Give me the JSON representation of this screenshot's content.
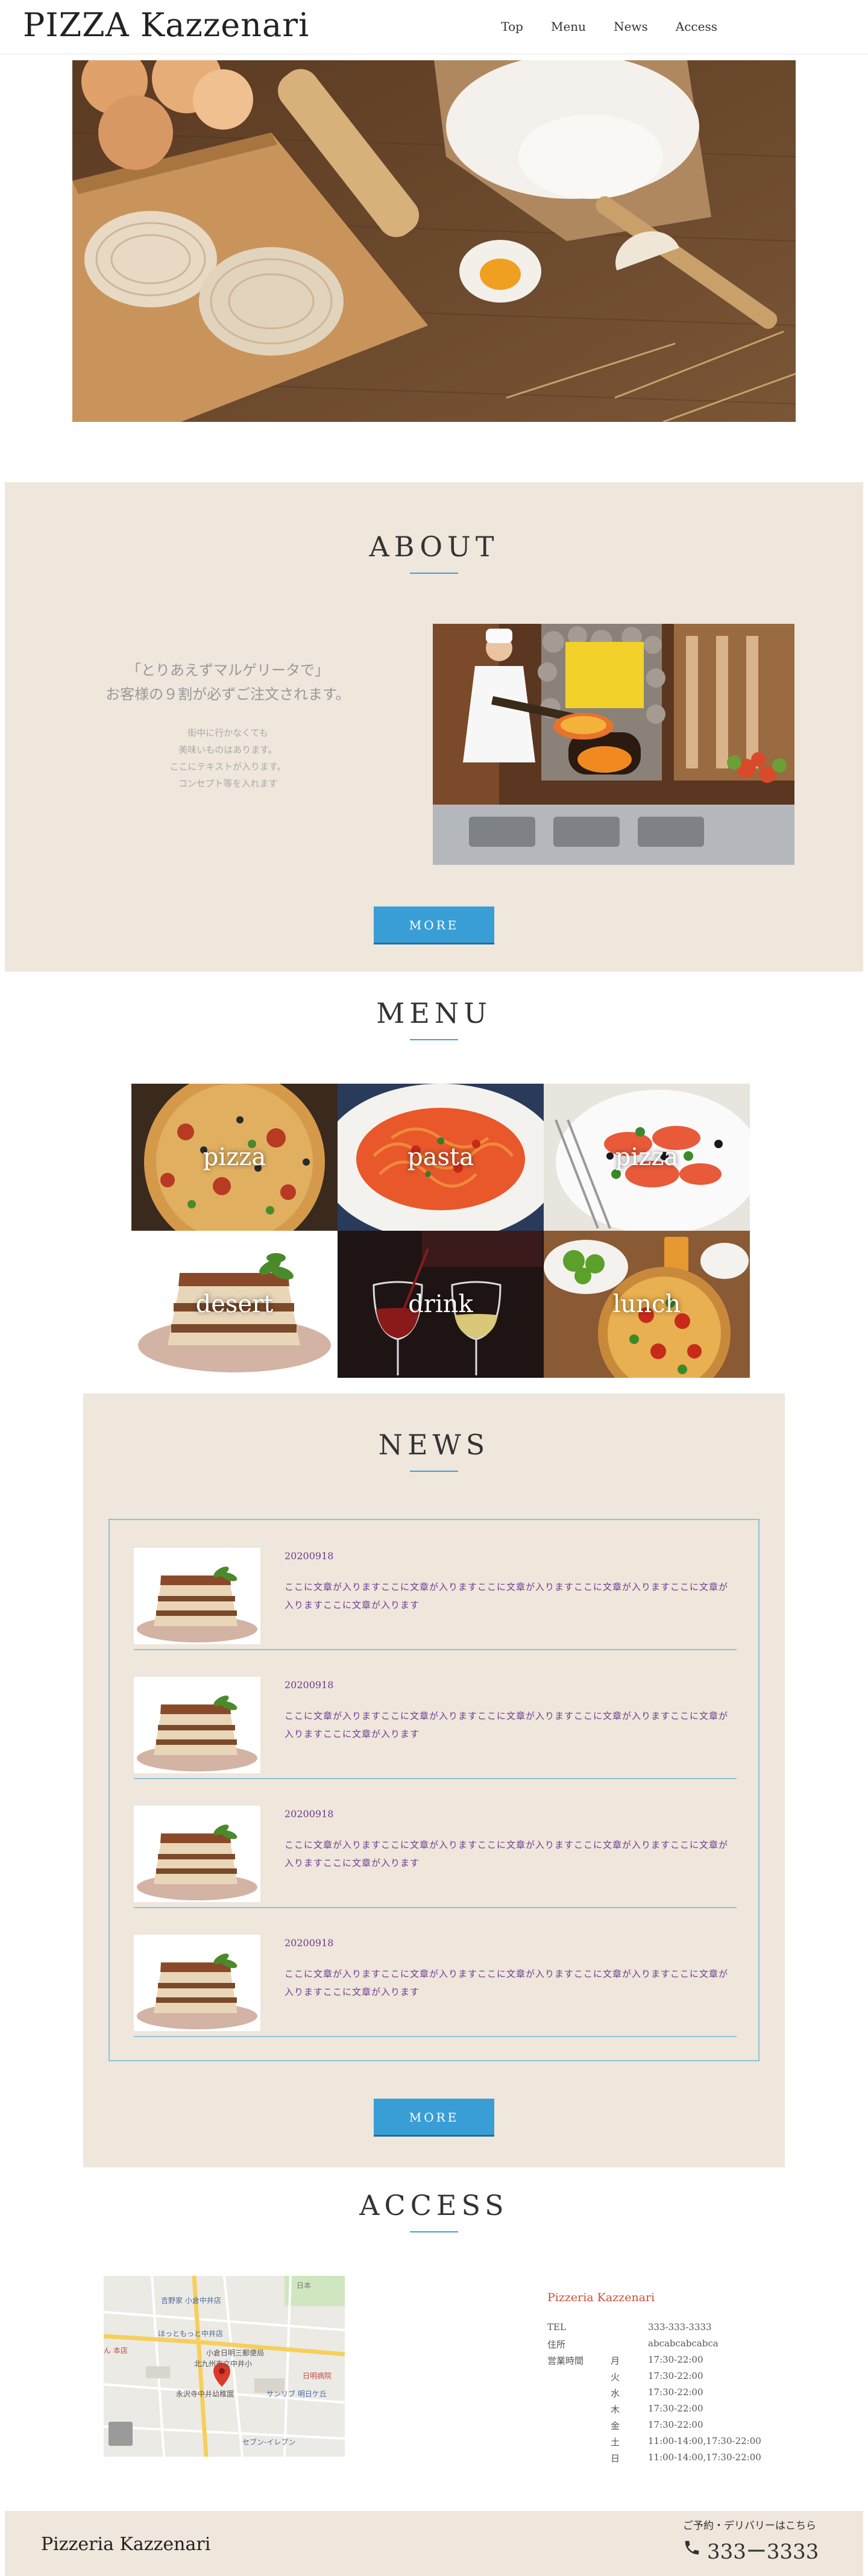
{
  "header": {
    "logo": "PIZZA Kazzenari",
    "nav": [
      "Top",
      "Menu",
      "News",
      "Access"
    ]
  },
  "about": {
    "title": "ABOUT",
    "lead_line1": "「とりあえずマルゲリータで」",
    "lead_line2": "お客様の９割が必ずご注文されます。",
    "text_lines": [
      "街中に行かなくても",
      "美味いものはあります。",
      "ここにテキストが入ります。",
      "コンセプト等を入れます"
    ],
    "more": "MORE"
  },
  "menu": {
    "title": "MENU",
    "tiles": [
      "pizza",
      "pasta",
      "pizza",
      "desert",
      "drink",
      "lunch"
    ]
  },
  "news": {
    "title": "NEWS",
    "items": [
      {
        "date": "20200918",
        "text": "ここに文章が入りますここに文章が入りますここに文章が入りますここに文章が入りますここに文章が入りますここに文章が入ります"
      },
      {
        "date": "20200918",
        "text": "ここに文章が入りますここに文章が入りますここに文章が入りますここに文章が入りますここに文章が入りますここに文章が入ります"
      },
      {
        "date": "20200918",
        "text": "ここに文章が入りますここに文章が入りますここに文章が入りますここに文章が入りますここに文章が入りますここに文章が入ります"
      },
      {
        "date": "20200918",
        "text": "ここに文章が入りますここに文章が入りますここに文章が入りますここに文章が入りますここに文章が入りますここに文章が入ります"
      }
    ],
    "more": "MORE"
  },
  "access": {
    "title": "ACCESS",
    "shop_name": "Pizzeria Kazzenari",
    "tel_label": "TEL",
    "tel": "333-333-3333",
    "address_label": "住所",
    "address": "abcabcabcabca",
    "hours_label": "営業時間",
    "hours": [
      {
        "day": "月",
        "time": "17:30-22:00"
      },
      {
        "day": "火",
        "time": "17:30-22:00"
      },
      {
        "day": "水",
        "time": "17:30-22:00"
      },
      {
        "day": "木",
        "time": "17:30-22:00"
      },
      {
        "day": "金",
        "time": "17:30-22:00"
      },
      {
        "day": "土",
        "time": "11:00-14:00,17:30-22:00"
      },
      {
        "day": "日",
        "time": "11:00-14:00,17:30-22:00"
      }
    ],
    "map_labels": [
      "吉野家 小倉中井店",
      "ほっともっと中井店",
      "小倉日明三郵便局",
      "北九州市立中井小",
      "永沢寺中井幼稚園",
      "日明病院",
      "サンリブ 明日ケ丘",
      "セブン-イレブン",
      "ん 本店",
      "日本"
    ]
  },
  "footer": {
    "name": "Pizzeria Kazzenari",
    "note": "ご予約・デリバリーはこちら",
    "tel": "333ー3333"
  },
  "colors": {
    "beige": "#efe6dc",
    "button_blue": "#3a9ed6",
    "news_text": "#6a3d8f",
    "shop_name_red": "#d24b3a"
  },
  "icons": [
    "phone-icon",
    "map-pin-icon"
  ]
}
